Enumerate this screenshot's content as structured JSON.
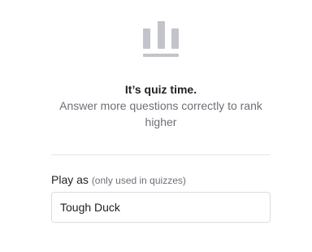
{
  "empty_state": {
    "icon": "leaderboard-bars-icon",
    "heading": "It’s quiz time.",
    "subtext": "Answer more questions correctly to rank higher"
  },
  "player_field": {
    "label": "Play as",
    "hint": "(only used in quizzes)",
    "value": "Tough Duck"
  },
  "colors": {
    "icon_gray": "#c3c4ca",
    "heading_text": "#1f2023",
    "muted_text": "#6e6f78",
    "divider": "#e4e5e9",
    "input_border": "#dcdde2"
  }
}
